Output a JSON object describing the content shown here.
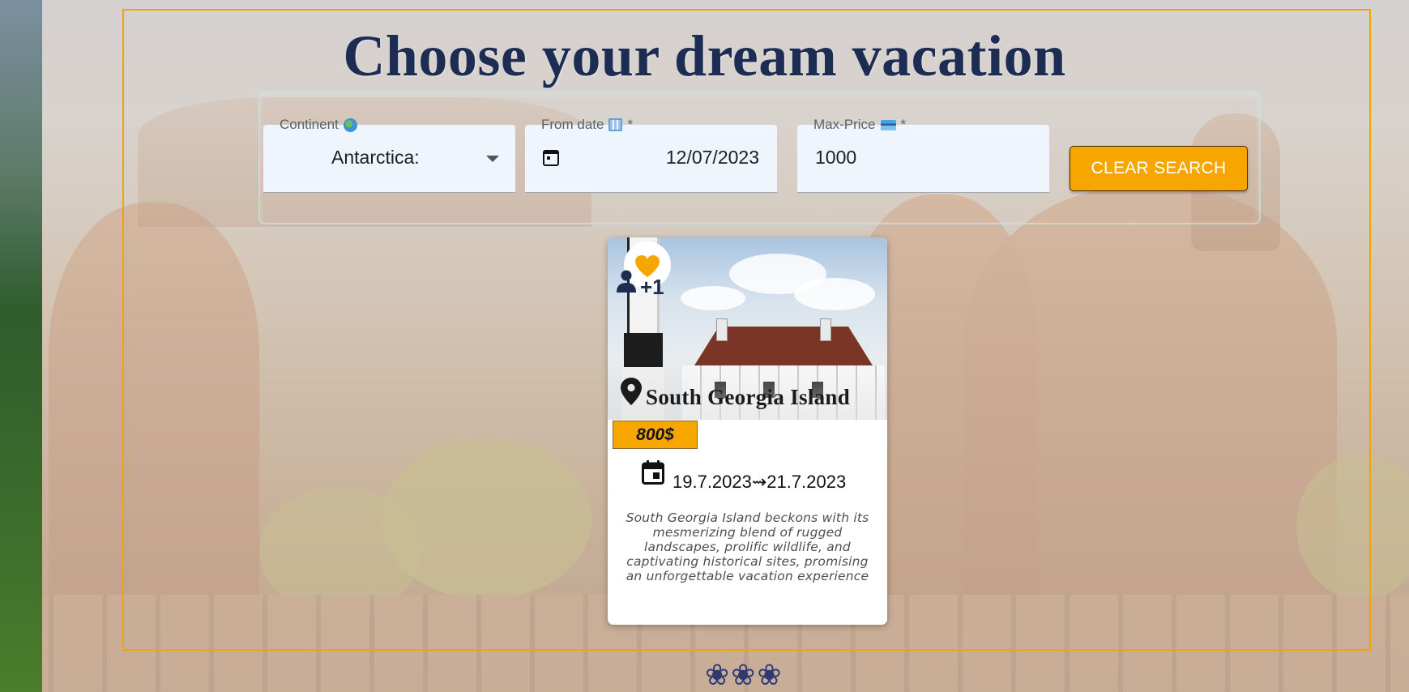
{
  "page": {
    "title": "Choose your dream vacation"
  },
  "search": {
    "continent": {
      "label": "Continent",
      "value": "Antarctica:",
      "icon": "globe-icon"
    },
    "from_date": {
      "label": "From date",
      "required_mark": "*",
      "value": "12/07/2023",
      "icon": "calendar-icon"
    },
    "max_price": {
      "label": "Max-Price",
      "required_mark": "*",
      "value": "1000",
      "icon": "credit-card-icon"
    },
    "clear_label": "Clear Search"
  },
  "trip": {
    "destination": "South Georgia Island",
    "likes": "+1",
    "price": "800$",
    "dates": "19.7.2023⇝21.7.2023",
    "description": "South Georgia Island beckons with its mesmerizing blend of rugged landscapes, prolific wildlife, and captivating historical sites, promising an unforgettable vacation experience"
  },
  "footer": {
    "decoration": "❀❀❀"
  },
  "colors": {
    "accent": "#f7a600",
    "title": "#1d2c52",
    "field_bg": "#eef5fd",
    "frame": "#f5a300"
  }
}
